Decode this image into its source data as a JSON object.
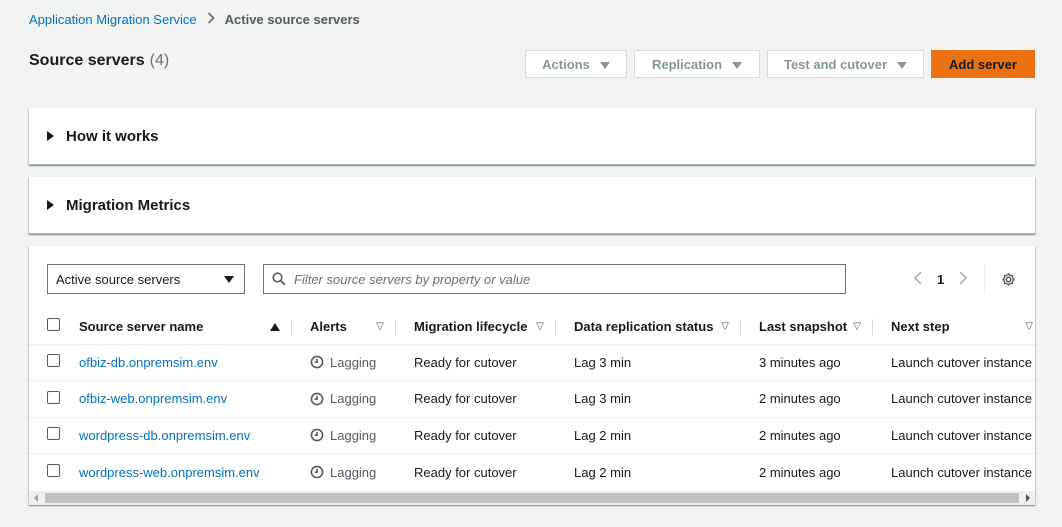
{
  "breadcrumb": {
    "root": "Application Migration Service",
    "current": "Active source servers"
  },
  "header": {
    "title": "Source servers",
    "count": "(4)"
  },
  "actions": {
    "actions_label": "Actions",
    "replication_label": "Replication",
    "test_cutover_label": "Test and cutover",
    "add_server_label": "Add server"
  },
  "expanders": {
    "how_it_works": "How it works",
    "migration_metrics": "Migration Metrics"
  },
  "filter": {
    "view_selected": "Active source servers",
    "search_placeholder": "Filter source servers by property or value",
    "search_value": ""
  },
  "pagination": {
    "current_page": "1"
  },
  "table": {
    "columns": {
      "name": "Source server name",
      "alerts": "Alerts",
      "lifecycle": "Migration lifecycle",
      "replication": "Data replication status",
      "snapshot": "Last snapshot",
      "next_step": "Next step"
    },
    "rows": [
      {
        "name": "ofbiz-db.onpremsim.env",
        "alert": "Lagging",
        "lifecycle": "Ready for cutover",
        "replication": "Lag 3 min",
        "snapshot": "3 minutes ago",
        "next_step": "Launch cutover instance"
      },
      {
        "name": "ofbiz-web.onpremsim.env",
        "alert": "Lagging",
        "lifecycle": "Ready for cutover",
        "replication": "Lag 3 min",
        "snapshot": "2 minutes ago",
        "next_step": "Launch cutover instance"
      },
      {
        "name": "wordpress-db.onpremsim.env",
        "alert": "Lagging",
        "lifecycle": "Ready for cutover",
        "replication": "Lag 2 min",
        "snapshot": "2 minutes ago",
        "next_step": "Launch cutover instance"
      },
      {
        "name": "wordpress-web.onpremsim.env",
        "alert": "Lagging",
        "lifecycle": "Ready for cutover",
        "replication": "Lag 2 min",
        "snapshot": "2 minutes ago",
        "next_step": "Launch cutover instance"
      }
    ]
  },
  "colors": {
    "link": "#0073bb",
    "primary_button": "#ec7211",
    "background": "#f2f3f3"
  }
}
